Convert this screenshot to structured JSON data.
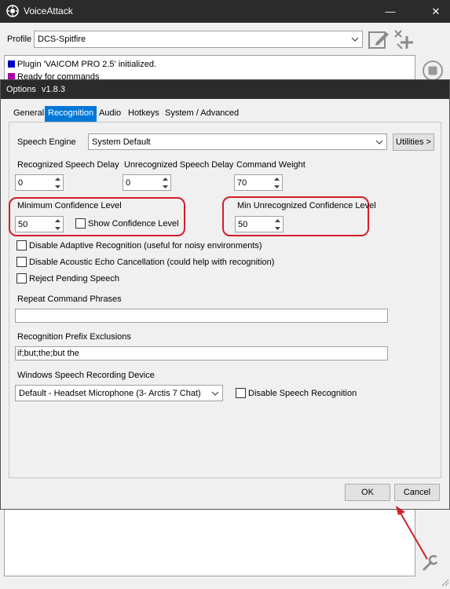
{
  "window": {
    "title": "VoiceAttack",
    "minimize": "—",
    "close": "✕"
  },
  "profile": {
    "label": "Profile",
    "value": "DCS-Spitfire"
  },
  "log": [
    {
      "text": "Plugin 'VAICOM PRO 2.5' initialized.",
      "color": "#0000cc"
    },
    {
      "text": "Ready for commands",
      "color": "#aa00aa"
    }
  ],
  "dialog": {
    "title": "Options",
    "version": "v1.8.3",
    "tabs": [
      {
        "label": "General"
      },
      {
        "label": "Recognition",
        "active": true
      },
      {
        "label": "Audio"
      },
      {
        "label": "Hotkeys"
      },
      {
        "label": "System / Advanced"
      }
    ],
    "speech_engine": {
      "label": "Speech Engine",
      "value": "System Default",
      "utilities_label": "Utilities >"
    },
    "recognized_delay": {
      "label": "Recognized Speech Delay",
      "value": "0"
    },
    "unrecognized_delay": {
      "label": "Unrecognized Speech Delay",
      "value": "0"
    },
    "command_weight": {
      "label": "Command Weight",
      "value": "70"
    },
    "min_confidence": {
      "label": "Minimum Confidence Level",
      "value": "50",
      "show_label": "Show Confidence Level",
      "show_checked": false
    },
    "min_unrecognized_confidence": {
      "label": "Min Unrecognized Confidence Level",
      "value": "50"
    },
    "options": [
      {
        "label": "Disable Adaptive Recognition (useful for noisy environments)",
        "checked": false
      },
      {
        "label": "Disable Acoustic Echo Cancellation (could help with recognition)",
        "checked": false
      },
      {
        "label": "Reject Pending Speech",
        "checked": false
      }
    ],
    "repeat_phrases": {
      "label": "Repeat Command Phrases",
      "value": ""
    },
    "prefix_exclusions": {
      "label": "Recognition Prefix Exclusions",
      "value": "if;but;the;but the"
    },
    "recording_device": {
      "label": "Windows Speech Recording Device",
      "value": "Default - Headset Microphone (3- Arctis 7 Chat)",
      "disable_label": "Disable Speech Recognition",
      "disable_checked": false
    },
    "ok_label": "OK",
    "cancel_label": "Cancel"
  },
  "colors": {
    "titlebar": "#2b2b2b",
    "accent": "#0078d7",
    "highlight": "#d0202a"
  }
}
